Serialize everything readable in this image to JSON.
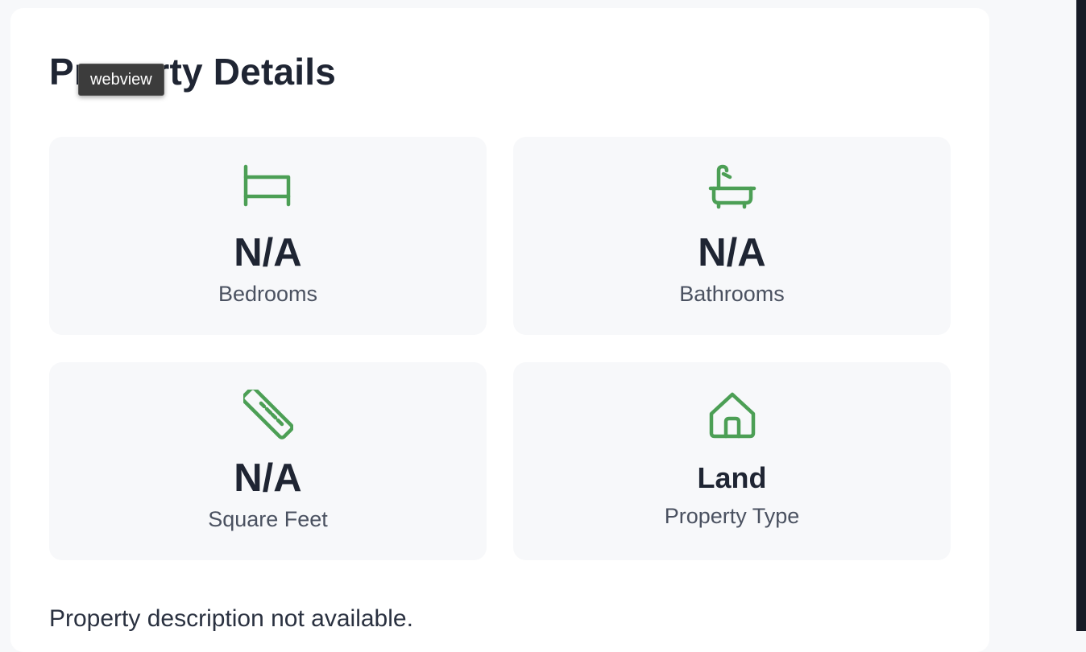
{
  "section": {
    "title": "Property Details"
  },
  "tooltip": {
    "text": "webview"
  },
  "details": {
    "bedrooms": {
      "value": "N/A",
      "label": "Bedrooms",
      "icon": "bed-icon"
    },
    "bathrooms": {
      "value": "N/A",
      "label": "Bathrooms",
      "icon": "bathtub-icon"
    },
    "square_feet": {
      "value": "N/A",
      "label": "Square Feet",
      "icon": "ruler-icon"
    },
    "property_type": {
      "value": "Land",
      "label": "Property Type",
      "icon": "home-icon"
    }
  },
  "description": "Property description not available.",
  "colors": {
    "icon_accent": "#4c9f55",
    "page_background": "#f7f8fa",
    "card_background": "#ffffff",
    "tile_background": "#f7f8fa",
    "heading_text": "#1f2533",
    "muted_text": "#4a5160"
  }
}
